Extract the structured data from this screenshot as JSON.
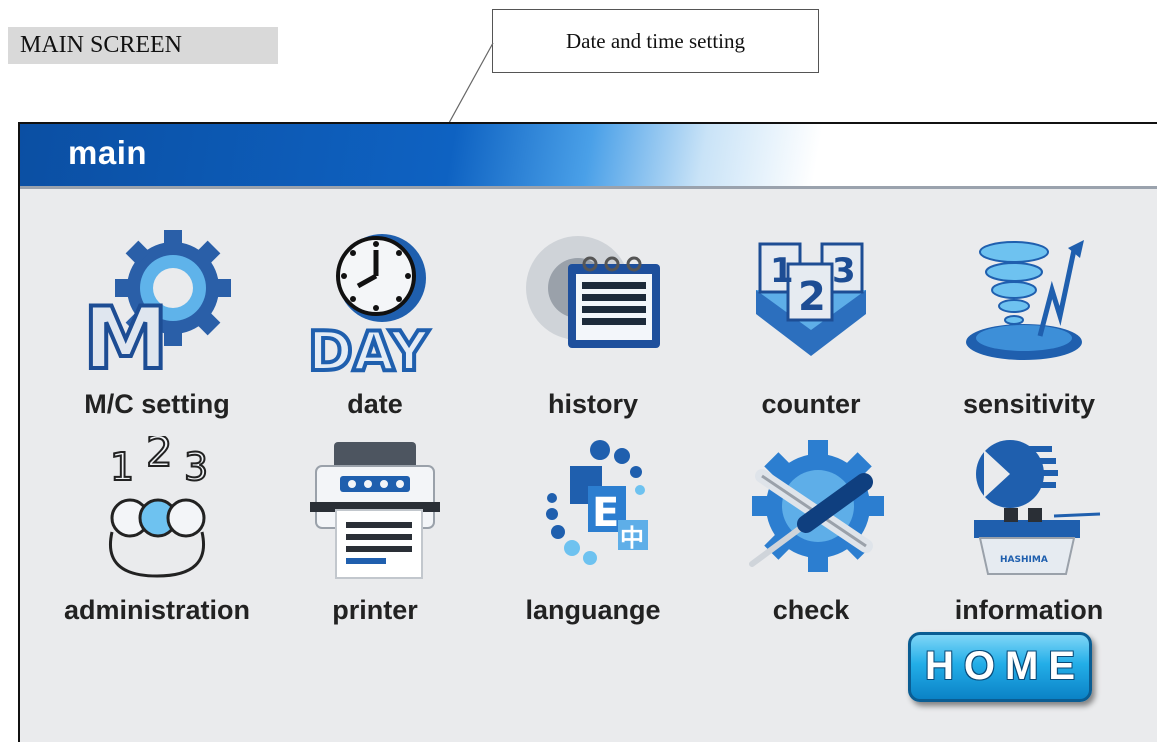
{
  "doc_label": "MAIN SCREEN",
  "callout": "Date and time setting",
  "window": {
    "title": "main"
  },
  "menu": [
    {
      "label": "M/C setting",
      "icon": "gear-m-icon"
    },
    {
      "label": "date",
      "icon": "clock-day-icon"
    },
    {
      "label": "history",
      "icon": "calendar-history-icon"
    },
    {
      "label": "counter",
      "icon": "counter-digits-icon"
    },
    {
      "label": "sensitivity",
      "icon": "tornado-sensitivity-icon"
    },
    {
      "label": "administration",
      "icon": "numbers-admin-icon"
    },
    {
      "label": "printer",
      "icon": "printer-icon"
    },
    {
      "label": "languange",
      "icon": "language-globe-icon"
    },
    {
      "label": "check",
      "icon": "wrench-screwdriver-icon"
    },
    {
      "label": "information",
      "icon": "company-info-icon"
    }
  ],
  "home_button": "HOME",
  "icon_text": {
    "clock": "DAY",
    "counter_digits": [
      "1",
      "2",
      "3"
    ],
    "admin_digits": [
      "1",
      "2",
      "3"
    ],
    "language_glyphs": [
      "E",
      "中"
    ],
    "company": "HASHIMA"
  },
  "colors": {
    "title_bar": "#0e62c2",
    "panel": "#eaebed",
    "home_button": "#23aee8"
  }
}
